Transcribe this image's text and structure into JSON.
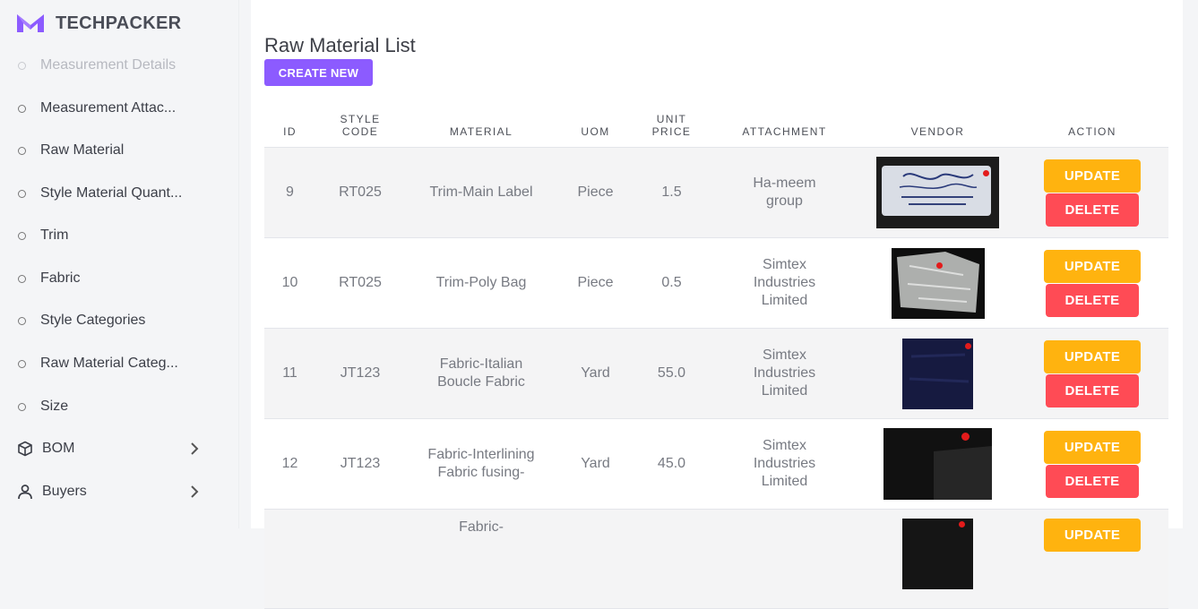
{
  "brand": {
    "name": "TECHPACKER",
    "logo_color": "#8c5bff"
  },
  "sidebar": {
    "items": [
      {
        "label": "Measurement Details",
        "icon": "circle-icon"
      },
      {
        "label": "Measurement Attac...",
        "icon": "circle-icon"
      },
      {
        "label": "Raw Material",
        "icon": "circle-icon"
      },
      {
        "label": "Style Material Quant...",
        "icon": "circle-icon"
      },
      {
        "label": "Trim",
        "icon": "circle-icon"
      },
      {
        "label": "Fabric",
        "icon": "circle-icon"
      },
      {
        "label": "Style Categories",
        "icon": "circle-icon"
      },
      {
        "label": "Raw Material Categ...",
        "icon": "circle-icon"
      },
      {
        "label": "Size",
        "icon": "circle-icon"
      },
      {
        "label": "BOM",
        "icon": "cube-icon"
      },
      {
        "label": "Buyers",
        "icon": "user-icon"
      }
    ]
  },
  "main": {
    "title": "Raw Material List",
    "create_label": "CREATE NEW",
    "columns": {
      "id": "ID",
      "style_code": "STYLE CODE",
      "material": "MATERIAL",
      "uom": "UOM",
      "unit_price": "UNIT PRICE",
      "attachment": "ATTACHMENT",
      "vendor": "VENDOR",
      "action": "ACTION"
    },
    "rows": [
      {
        "id": "9",
        "style_code": "RT025",
        "material": "Trim-Main Label",
        "uom": "Piece",
        "unit_price": "1.5",
        "attachment": "Ha-meem group",
        "vendor_image": "woven-label-photo"
      },
      {
        "id": "10",
        "style_code": "RT025",
        "material": "Trim-Poly Bag",
        "uom": "Piece",
        "unit_price": "0.5",
        "attachment": "Simtex Industries Limited",
        "vendor_image": "poly-bag-photo"
      },
      {
        "id": "11",
        "style_code": "JT123",
        "material": "Fabric-Italian Boucle Fabric",
        "uom": "Yard",
        "unit_price": "55.0",
        "attachment": "Simtex Industries Limited",
        "vendor_image": "navy-fabric-photo"
      },
      {
        "id": "12",
        "style_code": "JT123",
        "material": "Fabric-Interlining Fabric fusing-",
        "uom": "Yard",
        "unit_price": "45.0",
        "attachment": "Simtex Industries Limited",
        "vendor_image": "black-interlining-photo"
      },
      {
        "id": "",
        "style_code": "",
        "material": "Fabric-",
        "uom": "",
        "unit_price": "",
        "attachment": "",
        "vendor_image": "dark-fabric-photo"
      }
    ],
    "update_label": "UPDATE",
    "delete_label": "DELETE",
    "colors": {
      "update": "#ffb30f",
      "delete": "#ff4b55",
      "create": "#8c5bff"
    }
  }
}
